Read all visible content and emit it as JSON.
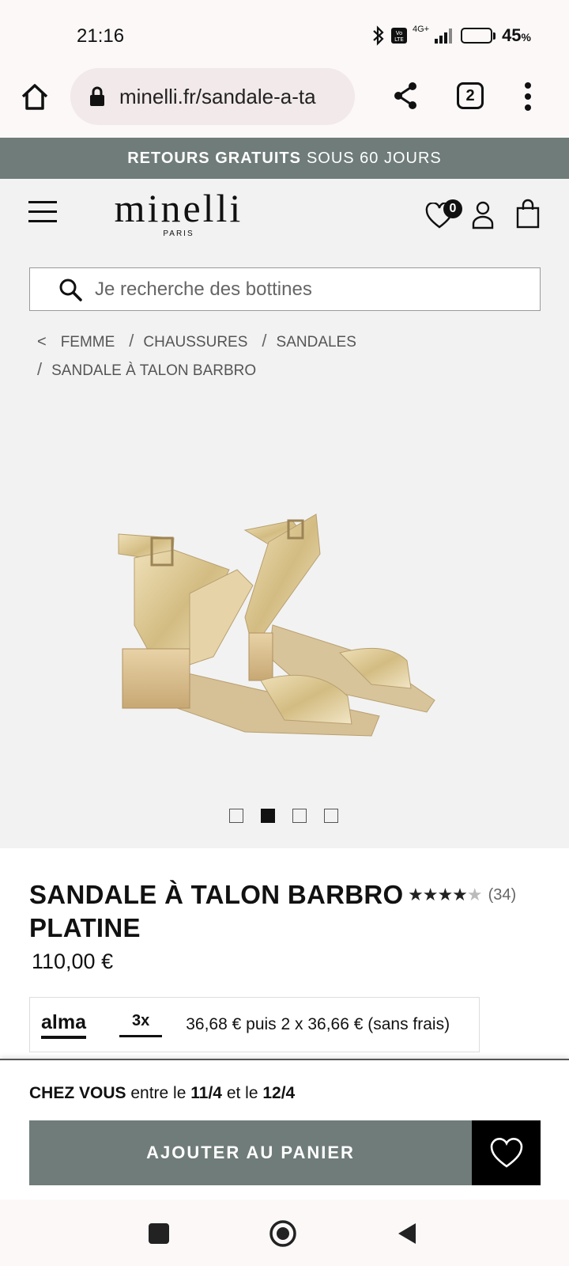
{
  "status_bar": {
    "time": "21:16",
    "network": "4G+",
    "battery_level": 0.45,
    "battery_text": "45",
    "battery_unit": "%"
  },
  "browser": {
    "url": "minelli.fr/sandale-a-ta",
    "tab_count": "2"
  },
  "promo": {
    "bold": "RETOURS GRATUITS",
    "rest": "SOUS 60 JOURS"
  },
  "header": {
    "logo": "minelli",
    "logo_sub": "PARIS",
    "wishlist_count": "0"
  },
  "search": {
    "placeholder": "Je recherche des bottines"
  },
  "breadcrumb": {
    "back": "<",
    "items": [
      "FEMME",
      "CHAUSSURES",
      "SANDALES",
      "SANDALE À TALON BARBRO"
    ],
    "separator": "/"
  },
  "carousel": {
    "count": 4,
    "active_index": 1
  },
  "product": {
    "title": "SANDALE À TALON BARBRO PLATINE",
    "rating": 4.5,
    "stars_full": "★★★★",
    "star_half": "★",
    "reviews": "(34)",
    "price": "110,00 €"
  },
  "alma": {
    "brand": "alma",
    "plan": "3x",
    "text": "36,68 € puis 2 x 36,66 € (sans frais)"
  },
  "delivery": {
    "label": "CHEZ VOUS",
    "text1": "entre le",
    "date1": "11/4",
    "text2": "et le",
    "date2": "12/4"
  },
  "cart": {
    "add_label": "AJOUTER AU PANIER"
  },
  "colors": {
    "accent": "#6f7c79",
    "page_bg": "#f2f2f2",
    "button_dark": "#000000"
  },
  "icons": [
    "home-icon",
    "lock-icon",
    "share-icon",
    "more-vert-icon",
    "hamburger-icon",
    "heart-icon",
    "user-icon",
    "bag-icon",
    "search-icon"
  ]
}
